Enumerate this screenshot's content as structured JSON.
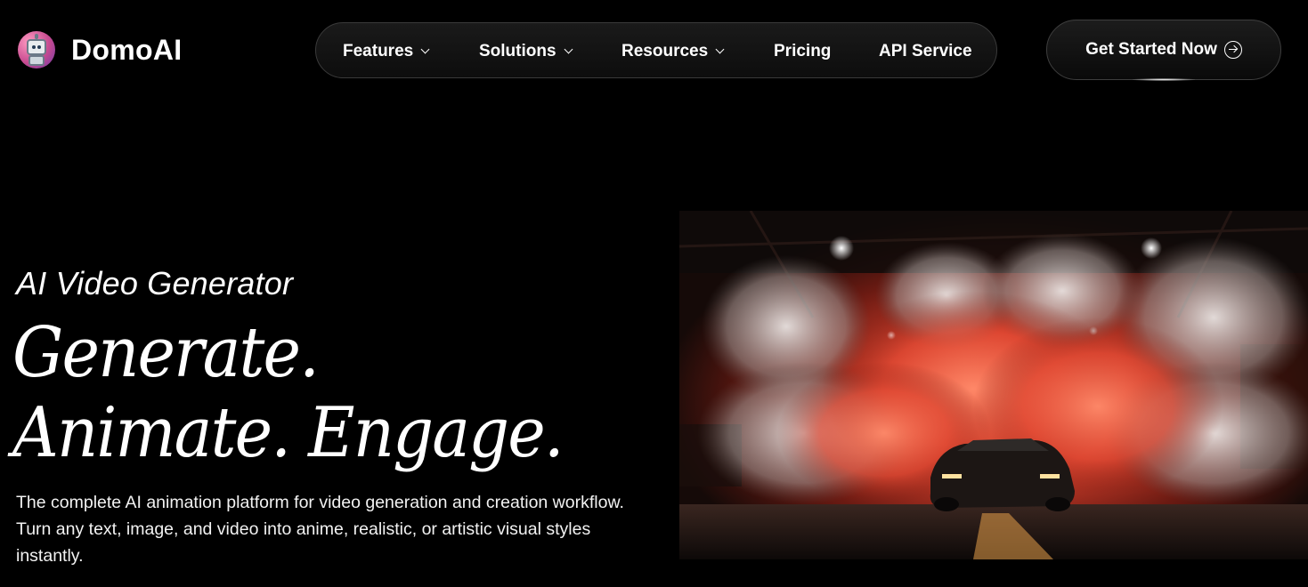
{
  "brand": {
    "name": "DomoAI",
    "logo_icon": "robot-logo-icon"
  },
  "nav": {
    "items": [
      {
        "label": "Features",
        "has_dropdown": true
      },
      {
        "label": "Solutions",
        "has_dropdown": true
      },
      {
        "label": "Resources",
        "has_dropdown": true
      },
      {
        "label": "Pricing",
        "has_dropdown": false
      },
      {
        "label": "API Service",
        "has_dropdown": false
      }
    ]
  },
  "cta": {
    "label": "Get Started Now",
    "icon": "arrow-circle-right-icon"
  },
  "hero": {
    "eyebrow": "AI Video Generator",
    "headline_line1": "Generate.",
    "headline_line2": "Animate. Engage.",
    "description": "The complete AI animation platform for video generation and creation workflow. Turn any text, image, and video into anime, realistic, or artistic visual styles instantly.",
    "image_icon": "hero-car-smoke-image"
  },
  "colors": {
    "background": "#000000",
    "text": "#ffffff",
    "nav_border": "#3a3a3a",
    "smoke_accent": "#e8503a"
  }
}
